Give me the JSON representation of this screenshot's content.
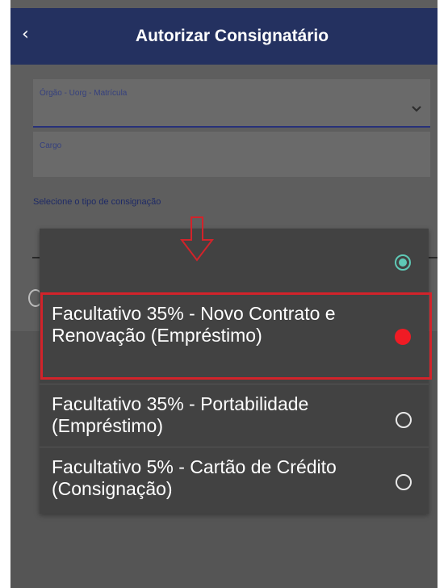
{
  "header": {
    "back_icon": "chevron-left-icon",
    "title": "Autorizar Consignatário",
    "color": "#243160"
  },
  "form": {
    "field1_label": "Órgão - Uorg - Matrícula",
    "field2_label": "Cargo",
    "section_label": "Selecione o tipo de consignação"
  },
  "dialog": {
    "options": [
      {
        "label": "",
        "selected": true
      },
      {
        "label": "Facultativo 35% - Novo Contrato e Renovação (Empréstimo)",
        "highlighted": true
      },
      {
        "label": "Facultativo 35% - Portabilidade (Empréstimo)"
      },
      {
        "label": "Facultativo 5% - Cartão de Crédito (Consignação)"
      }
    ],
    "accent": "#5fc9b6",
    "highlight_color": "#d2232a"
  }
}
